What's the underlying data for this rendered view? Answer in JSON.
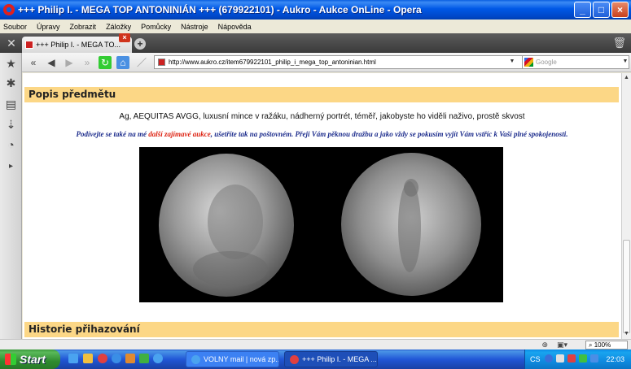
{
  "window": {
    "title": "+++ Philip I. - MEGA TOP ANTONINIÁN +++ (679922101) - Aukro - Aukce OnLine - Opera",
    "controls": {
      "minimize": "_",
      "maximize": "□",
      "close": "×"
    }
  },
  "menu": [
    "Soubor",
    "Úpravy",
    "Zobrazit",
    "Záložky",
    "Pomůcky",
    "Nástroje",
    "Nápověda"
  ],
  "tabs": [
    {
      "label": "+++ Philip I. - MEGA TO...",
      "close": "×"
    }
  ],
  "newtab_label": "+",
  "address": {
    "url": "http://www.aukro.cz/item679922101_philip_i_mega_top_antoninian.html",
    "search_placeholder": "Google"
  },
  "sidebar_icons": [
    "star-icon",
    "gear-icon",
    "notes-icon",
    "transfer-icon",
    "history-icon",
    "panel-toggle-icon"
  ],
  "page": {
    "section1_title": "Popis předmětu",
    "description": "Ag, AEQUITAS AVGG, luxusní mince v ražáku, nádherný portrét, téměř, jakobyste ho viděli naživo, prostě skvost",
    "promo_before": "Podívejte se také na mé ",
    "promo_link": "další zajímavé aukce",
    "promo_after": ", ušetříte tak na poštovném. Přeji Vám pěknou dražbu a jako vždy se pokusím vyjít Vám vstříc k Vaší plné spokojenosti.",
    "section2_title": "Historie přihazování"
  },
  "statusbar": {
    "zoom": "100%"
  },
  "taskbar": {
    "start": "Start",
    "tasks": [
      {
        "label": "VOLNY mail | nová zp...",
        "active": false
      },
      {
        "label": "+++ Philip I. - MEGA ...",
        "active": true
      }
    ],
    "lang": "CS",
    "clock": "22:03"
  }
}
